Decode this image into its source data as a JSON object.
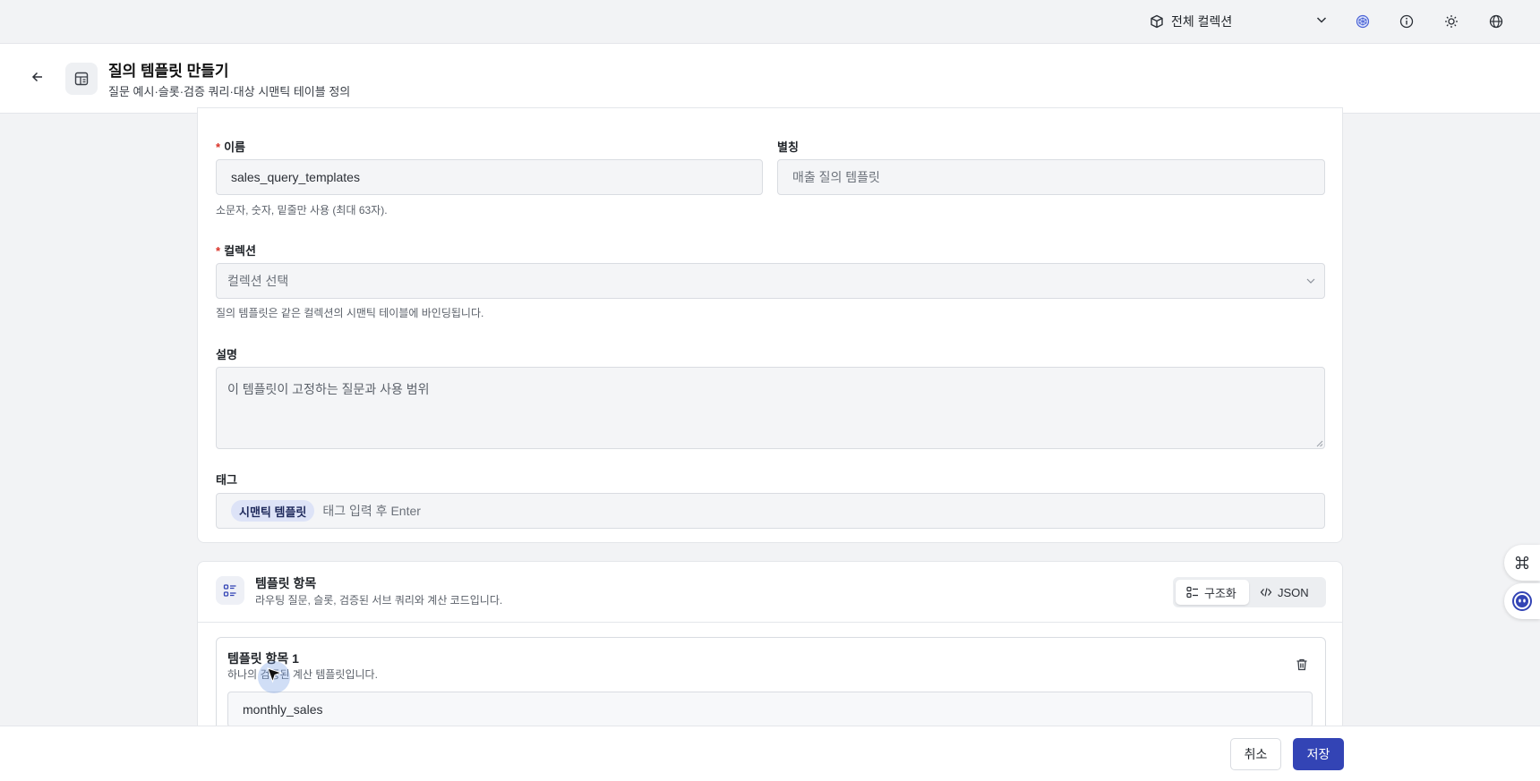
{
  "topbar": {
    "collection_label": "전체 컬렉션",
    "icons": [
      "cube-icon",
      "chevron-down-icon",
      "network-icon",
      "info-icon",
      "sun-icon",
      "globe-icon"
    ]
  },
  "header": {
    "title": "질의 템플릿 만들기",
    "subtitle": "질문 예시·슬롯·검증 쿼리·대상 시맨틱 테이블 정의"
  },
  "form": {
    "name_label": "이름",
    "name_value": "sales_query_templates",
    "name_hint": "소문자, 숫자, 밑줄만 사용 (최대 63자).",
    "alias_label": "별칭",
    "alias_placeholder": "매출 질의 템플릿",
    "collection_label": "컬렉션",
    "collection_placeholder": "컬렉션 선택",
    "collection_hint": "질의 템플릿은 같은 컬렉션의 시맨틱 테이블에 바인딩됩니다.",
    "description_label": "설명",
    "description_placeholder": "이 템플릿이 고정하는 질문과 사용 범위",
    "tags_label": "태그",
    "tags": [
      "시맨틱 템플릿"
    ],
    "tags_placeholder": "태그 입력 후 Enter",
    "required_mark": "*"
  },
  "template_section": {
    "title": "템플릿 항목",
    "subtitle": "라우팅 질문, 슬롯, 검증된 서브 쿼리와 계산 코드입니다.",
    "view_structured": "구조화",
    "view_json": "JSON",
    "items": [
      {
        "title": "템플릿 항목 1",
        "subtitle": "하나의 검증된 계산 템플릿입니다.",
        "name_value": "monthly_sales"
      }
    ]
  },
  "footer": {
    "cancel_label": "취소",
    "save_label": "저장"
  },
  "colors": {
    "accent": "#3344b5",
    "required": "#d93025",
    "tag_bg": "#dde3f7"
  }
}
